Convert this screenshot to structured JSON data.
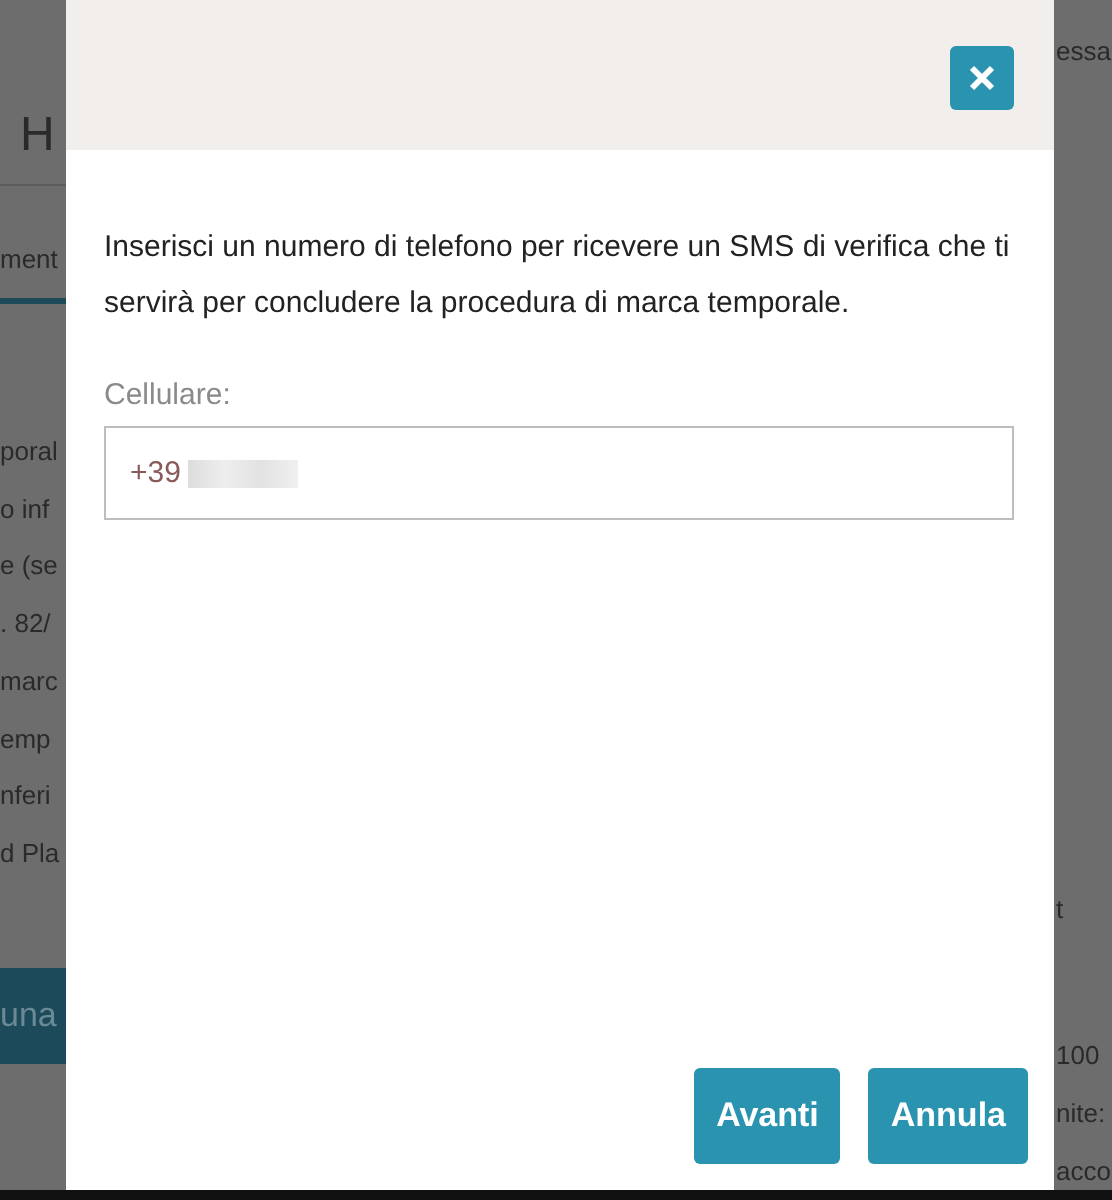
{
  "background_left": {
    "heading": "H",
    "tab": "ment",
    "lines": [
      "poral",
      "o inf",
      "e (se",
      ". 82/",
      "marc",
      "emp",
      "nferi",
      "d Pla"
    ],
    "button": "una"
  },
  "background_right": {
    "top": "essa",
    "lines": [
      {
        "kind": "header",
        "text": "t"
      },
      {
        "kind": "text",
        "text": "100"
      },
      {
        "kind": "text",
        "text": "nite:"
      },
      {
        "kind": "text",
        "text": "acco"
      }
    ]
  },
  "dialog": {
    "message": "Inserisci un numero di telefono per ricevere un SMS di verifica che ti servirà per concludere la procedura di marca temporale.",
    "field": {
      "label": "Cellulare:",
      "value": "+39"
    },
    "buttons": [
      "Avanti",
      "Annula"
    ]
  }
}
